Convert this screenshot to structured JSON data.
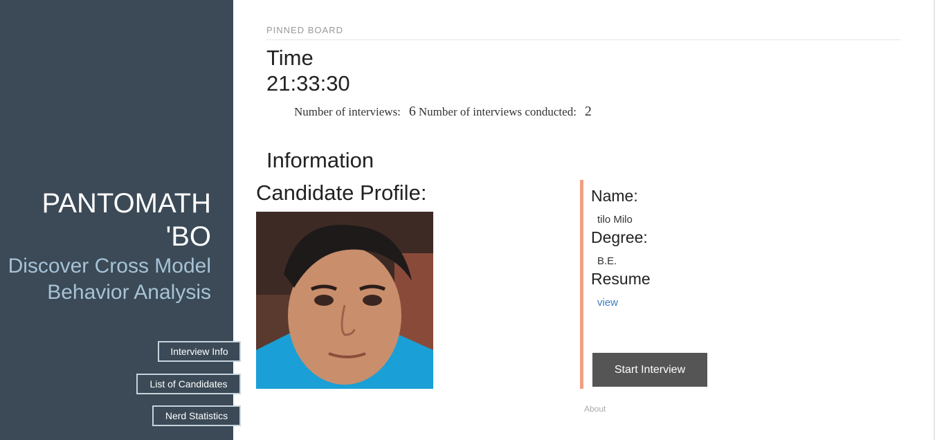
{
  "sidebar": {
    "brand_title": "PANTOMATH 'BO",
    "tagline": "Discover Cross Model Behavior Analysis",
    "nav": [
      {
        "label": "Interview Info"
      },
      {
        "label": "List of Candidates"
      },
      {
        "label": "Nerd Statistics"
      }
    ]
  },
  "board": {
    "pinned_label": "PINNED BOARD",
    "time_label": "Time",
    "time_value": "21:33:30",
    "interviews_label": "Number of interviews:",
    "interviews_count": "6",
    "conducted_label": "Number of interviews conducted:",
    "conducted_count": "2"
  },
  "info": {
    "heading": "Information",
    "profile_heading": "Candidate Profile:",
    "name_label": "Name:",
    "name_value": "tilo Milo",
    "degree_label": "Degree:",
    "degree_value": "B.E.",
    "resume_label": "Resume",
    "resume_link": "view",
    "start_button": "Start Interview"
  },
  "footer": {
    "about": "About"
  },
  "colors": {
    "sidebar_bg": "#3b4a56",
    "tagline": "#a6c2d6",
    "accent_border": "#f0a082",
    "button_bg": "#555555",
    "link": "#3a7fbf"
  }
}
